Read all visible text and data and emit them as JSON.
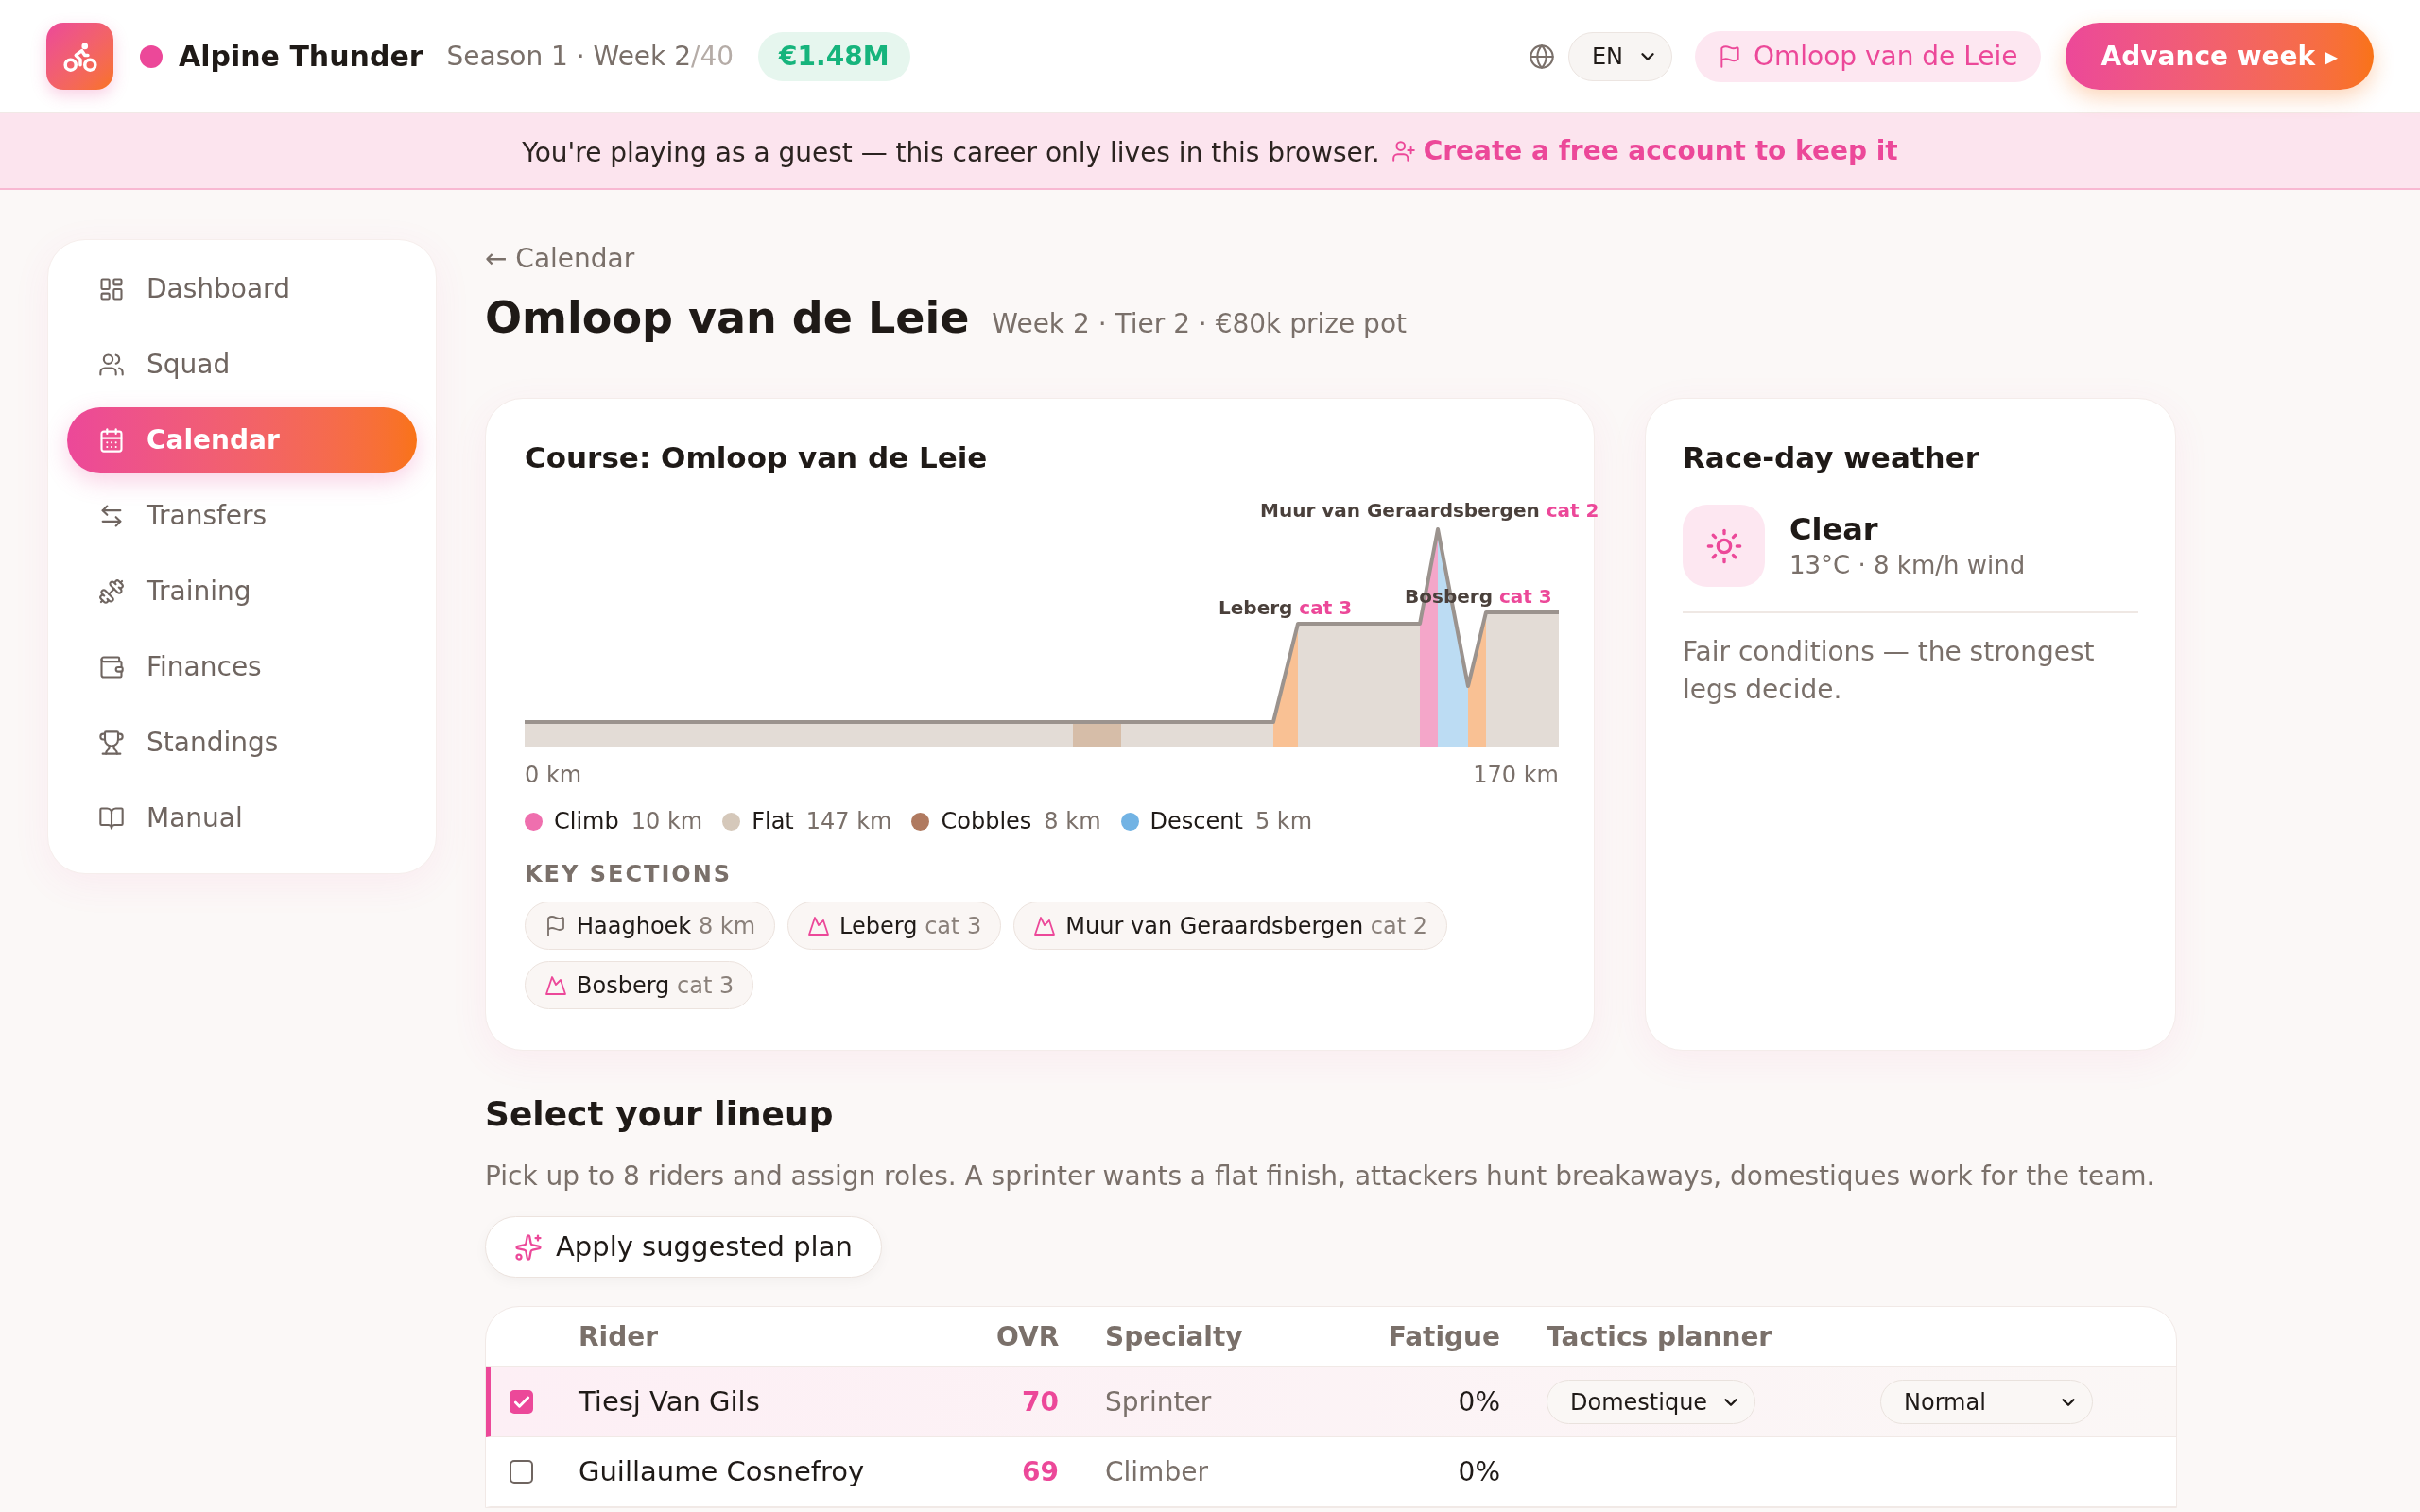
{
  "header": {
    "team_name": "Alpine Thunder",
    "season_week": "Season 1 · Week 2",
    "week_total": "/40",
    "balance": "€1.48M",
    "language": "EN",
    "race_button": "Omloop van de Leie",
    "advance_button": "Advance week ▸"
  },
  "banner": {
    "message": "You're playing as a guest — this career only lives in this browser.",
    "link": "Create a free account to keep it"
  },
  "sidebar": {
    "items": [
      {
        "label": "Dashboard",
        "selected": false
      },
      {
        "label": "Squad",
        "selected": false
      },
      {
        "label": "Calendar",
        "selected": true
      },
      {
        "label": "Transfers",
        "selected": false
      },
      {
        "label": "Training",
        "selected": false
      },
      {
        "label": "Finances",
        "selected": false
      },
      {
        "label": "Standings",
        "selected": false
      },
      {
        "label": "Manual",
        "selected": false
      }
    ]
  },
  "page": {
    "back_link": "← Calendar",
    "title": "Omloop van de Leie",
    "meta": "Week 2 · Tier 2 · €80k prize pot"
  },
  "course": {
    "title": "Course: Omloop van de Leie",
    "profile": {
      "climbs": [
        {
          "name": "Muur van Geraardsbergen",
          "category": "cat 2"
        },
        {
          "name": "Leberg",
          "category": "cat 3"
        },
        {
          "name": "Bosberg",
          "category": "cat 3"
        }
      ],
      "start_label": "0 km",
      "end_label": "170 km"
    },
    "legend": [
      {
        "name": "Climb",
        "distance": "10 km",
        "color": "#ef6fae"
      },
      {
        "name": "Flat",
        "distance": "147 km",
        "color": "#d5c8ba"
      },
      {
        "name": "Cobbles",
        "distance": "8 km",
        "color": "#b07a60"
      },
      {
        "name": "Descent",
        "distance": "5 km",
        "color": "#72b3e4"
      }
    ],
    "key_sections_heading": "KEY SECTIONS",
    "key_sections": [
      {
        "kind": "sector",
        "name": "Haaghoek",
        "detail": "8 km"
      },
      {
        "kind": "climb",
        "name": "Leberg",
        "detail": "cat 3"
      },
      {
        "kind": "climb",
        "name": "Muur van Geraardsbergen",
        "detail": "cat 2"
      },
      {
        "kind": "climb",
        "name": "Bosberg",
        "detail": "cat 3"
      }
    ]
  },
  "weather": {
    "title": "Race-day weather",
    "condition": "Clear",
    "details": "13°C · 8 km/h wind",
    "note": "Fair conditions — the strongest legs decide."
  },
  "lineup": {
    "title": "Select your lineup",
    "description": "Pick up to 8 riders and assign roles. A sprinter wants a flat finish, attackers hunt breakaways, domestiques work for the team.",
    "suggest_button": "Apply suggested plan",
    "table": {
      "columns": [
        "Rider",
        "OVR",
        "Specialty",
        "Fatigue",
        "Tactics planner"
      ],
      "rows": [
        {
          "selected": true,
          "rider": "Tiesj Van Gils",
          "ovr": "70",
          "specialty": "Sprinter",
          "fatigue": "0%",
          "role": "Domestique",
          "effort": "Normal"
        },
        {
          "selected": false,
          "rider": "Guillaume Cosnefroy",
          "ovr": "69",
          "specialty": "Climber",
          "fatigue": "0%"
        }
      ]
    }
  }
}
